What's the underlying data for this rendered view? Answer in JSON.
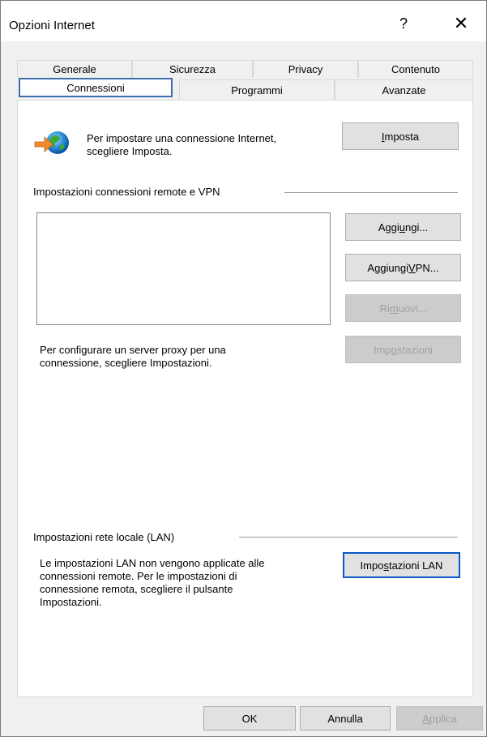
{
  "window": {
    "title": "Opzioni Internet",
    "help_glyph": "?",
    "close_glyph": "✕"
  },
  "tabs_row1": [
    {
      "label": "Generale"
    },
    {
      "label": "Sicurezza"
    },
    {
      "label": "Privacy"
    },
    {
      "label": "Contenuto"
    }
  ],
  "tabs_row2": [
    {
      "label": "Connessioni",
      "active": true
    },
    {
      "label": "Programmi"
    },
    {
      "label": "Avanzate"
    }
  ],
  "setup": {
    "icon": "globe-arrow-icon",
    "text_line1": "Per impostare una connessione Internet,",
    "text_line2": "scegliere Imposta.",
    "button_pre": "",
    "button_ul": "I",
    "button_post": "mposta"
  },
  "remote": {
    "group_label": "Impostazioni connessioni remote e VPN",
    "add_pre": "Aggi",
    "add_ul": "u",
    "add_post": "ngi...",
    "addvpn_pre": "Aggiungi ",
    "addvpn_ul": "V",
    "addvpn_post": "PN...",
    "remove_pre": "Ri",
    "remove_ul": "m",
    "remove_post": "uovi...",
    "settings_pre": "Imp",
    "settings_ul": "o",
    "settings_post": "stazioni",
    "proxy_line1": "Per configurare un server proxy per una",
    "proxy_line2": "connessione, scegliere Impostazioni."
  },
  "lan": {
    "group_label": "Impostazioni rete locale (LAN)",
    "text_line1": "Le impostazioni LAN non vengono applicate alle",
    "text_line2": "connessioni remote. Per le impostazioni di",
    "text_line3": "connessione remota, scegliere il pulsante",
    "text_line4": "Impostazioni.",
    "btn_pre": "Impo",
    "btn_ul": "s",
    "btn_post": "tazioni LAN"
  },
  "footer": {
    "ok": "OK",
    "cancel": "Annulla",
    "apply_pre": "",
    "apply_ul": "A",
    "apply_post": "pplica"
  },
  "colors": {
    "accent": "#0b58c8",
    "tab_focus": "#3c6dad",
    "disabled_text": "#a0a0a0"
  }
}
